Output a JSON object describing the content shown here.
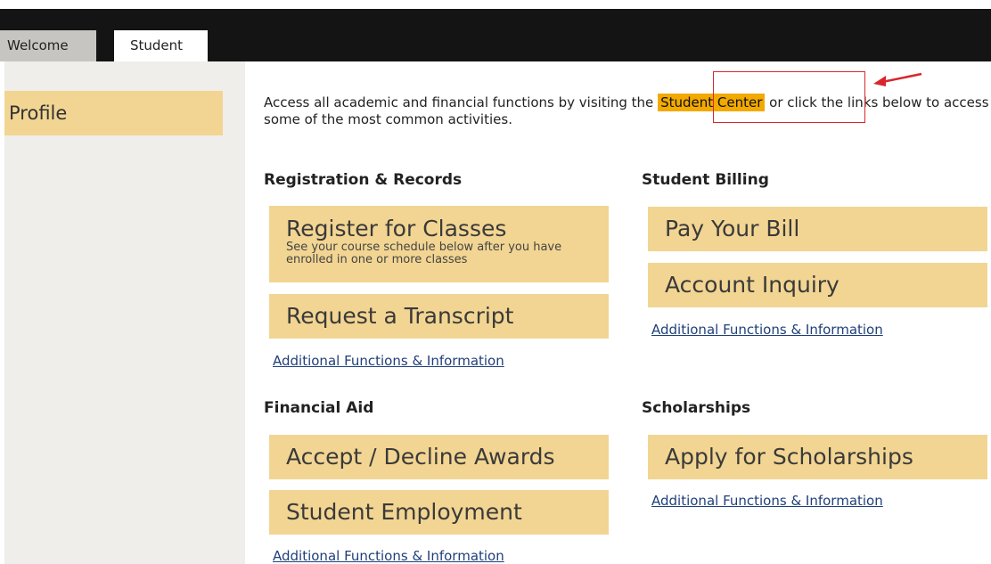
{
  "tabs": {
    "welcome": "Welcome",
    "student": "Student"
  },
  "sidebar": {
    "profile": "Profile"
  },
  "intro": {
    "before": "Access all academic and financial functions by visiting the ",
    "highlight": "Student Center",
    "after": " or click the links below to access some of the most common activities."
  },
  "registration": {
    "title": "Registration & Records",
    "register_title": "Register for Classes",
    "register_sub": "See your course schedule below after you have enrolled in one or more classes",
    "transcript": "Request a Transcript",
    "more": "Additional Functions & Information"
  },
  "billing": {
    "title": "Student Billing",
    "pay": "Pay Your Bill",
    "inquiry": "Account Inquiry",
    "more": "Additional Functions & Information"
  },
  "financial_aid": {
    "title": "Financial Aid",
    "awards": "Accept / Decline Awards",
    "employment": "Student Employment",
    "more": "Additional Functions & Information"
  },
  "scholarships": {
    "title": "Scholarships",
    "apply": "Apply for Scholarships",
    "more": "Additional Functions & Information"
  },
  "colors": {
    "tile": "#f2d592",
    "highlight": "#f2a900",
    "annotation": "#d9262c",
    "link": "#1f3f7a"
  }
}
